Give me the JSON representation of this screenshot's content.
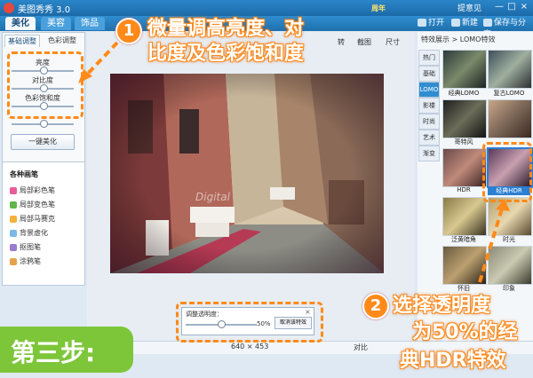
{
  "window": {
    "title": "美图秀秀 3.0",
    "anniversary": "周年",
    "user": "提意见",
    "controls": [
      "—",
      "□",
      "×"
    ]
  },
  "main_tabs": [
    {
      "label": "美化"
    },
    {
      "label": "美容"
    },
    {
      "label": "饰品"
    }
  ],
  "top_buttons": {
    "open": "打开",
    "new": "新建",
    "save": "保存与分享"
  },
  "left_panel": {
    "tabs": [
      "基础调整",
      "色彩调整"
    ],
    "sliders": [
      {
        "label": "亮度"
      },
      {
        "label": "对比度"
      },
      {
        "label": "色彩饱和度"
      }
    ],
    "one_key": "一键美化",
    "brushes_title": "各种画笔",
    "brushes": [
      "局部彩色笔",
      "局部变色笔",
      "局部马赛克",
      "背景虚化",
      "抠图笔",
      "涂鸦笔"
    ]
  },
  "toolbar": {
    "item_a": "转",
    "item_b": "截图",
    "item_c": "尺寸"
  },
  "opacity_panel": {
    "label": "调整透明度：",
    "value": "50%",
    "value_fraction": 0.5,
    "cancel": "取消该特效",
    "close": "×"
  },
  "status": {
    "dimensions": "640 × 453",
    "compare": "对比"
  },
  "right_panel": {
    "header": "特效展示 > LOMO特效",
    "categories": [
      "热门",
      "基础",
      "LOMO",
      "影楼",
      "时尚",
      "艺术",
      "渐变"
    ],
    "active_category": "LOMO",
    "effects": [
      {
        "label": "经典LOMO"
      },
      {
        "label": "复古LOMO"
      },
      {
        "label": "哥特风"
      },
      {
        "label": ""
      },
      {
        "label": "HDR"
      },
      {
        "label": "经典HDR"
      },
      {
        "label": "泛黄暗角"
      },
      {
        "label": "时光"
      },
      {
        "label": "怀旧"
      },
      {
        "label": "印象"
      }
    ],
    "selected_effect": "经典HDR"
  },
  "callouts": {
    "step1_number": "1",
    "step1_line1": "微量调高亮度、对",
    "step1_line2": "比度及色彩饱和度",
    "step2_number": "2",
    "step2_line1": "选择透明度",
    "step2_line2": "为50%的经",
    "step2_line3": "典HDR特效",
    "step_banner": "第三步:"
  },
  "watermark": "Digital",
  "colors": {
    "accent_orange": "#ff8a1a",
    "title_blue": "#1c6aa8",
    "select_blue": "#2b7fd2",
    "step_green": "#7dc63a"
  }
}
